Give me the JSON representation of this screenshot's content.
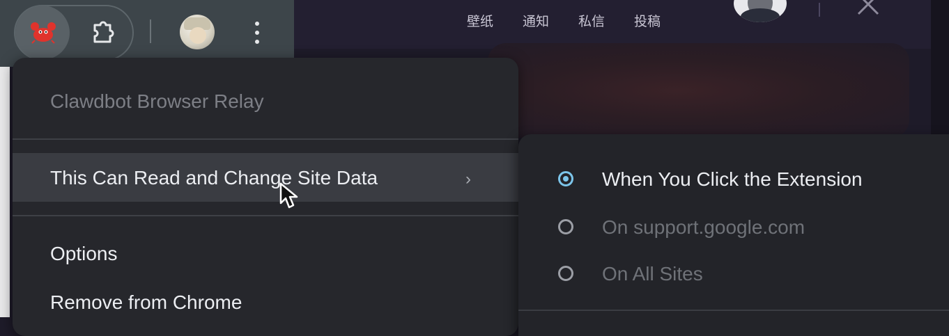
{
  "top_nav": {
    "links": [
      "壁纸",
      "通知",
      "私信",
      "投稿"
    ]
  },
  "toolbar": {
    "icons": [
      "crab-extension-icon",
      "puzzle-icon",
      "profile-avatar",
      "kebab-menu-icon"
    ]
  },
  "context_menu": {
    "title": "Clawdbot Browser Relay",
    "site_access_label": "This Can Read and Change Site Data",
    "chevron": "›",
    "options_label": "Options",
    "remove_label": "Remove from Chrome"
  },
  "submenu": {
    "options": [
      {
        "label": "When You Click the Extension",
        "selected": true
      },
      {
        "label": "On support.google.com",
        "selected": false
      },
      {
        "label": "On All Sites",
        "selected": false
      }
    ]
  },
  "colors": {
    "accent": "#7cc5ea",
    "menu_bg": "#26272c",
    "page_bg": "#1e1b29"
  }
}
